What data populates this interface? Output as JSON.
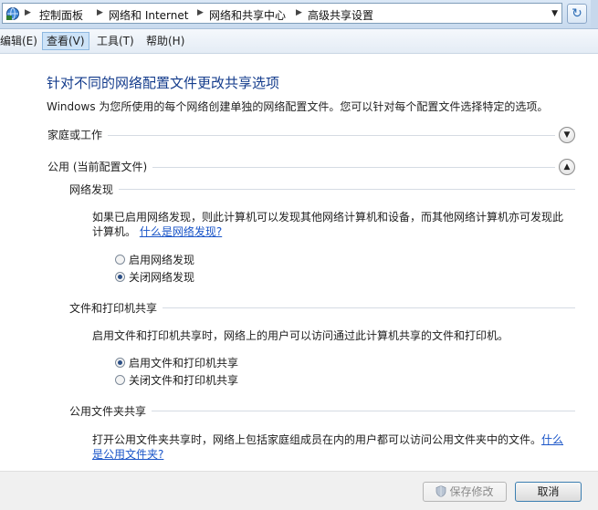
{
  "address_bar": {
    "crumbs": [
      "控制面板",
      "网络和 Internet",
      "网络和共享中心",
      "高级共享设置"
    ],
    "icon": "network-folder-icon",
    "dropdown_icon": "chevron-down-icon",
    "refresh_icon": "refresh-icon"
  },
  "menu": {
    "items": [
      "编辑(E)",
      "查看(V)",
      "工具(T)",
      "帮助(H)"
    ],
    "active_index": 1
  },
  "content": {
    "title": "针对不同的网络配置文件更改共享选项",
    "intro": "Windows 为您所使用的每个网络创建单独的网络配置文件。您可以针对每个配置文件选择特定的选项。",
    "profiles": [
      {
        "label": "家庭或工作",
        "expanded": false
      },
      {
        "label": "公用 (当前配置文件)",
        "expanded": true
      }
    ],
    "network_discovery": {
      "heading": "网络发现",
      "desc_line1": "如果已启用网络发现，则此计算机可以发现其他网络计算机和设备，而其他网络计算机亦可发现此",
      "desc_line2": "计算机。",
      "link": "什么是网络发现?",
      "options": [
        "启用网络发现",
        "关闭网络发现"
      ],
      "selected": 1
    },
    "file_printer_sharing": {
      "heading": "文件和打印机共享",
      "desc": "启用文件和打印机共享时，网络上的用户可以访问通过此计算机共享的文件和打印机。",
      "options": [
        "启用文件和打印机共享",
        "关闭文件和打印机共享"
      ],
      "selected": 0
    },
    "public_folder_sharing": {
      "heading": "公用文件夹共享",
      "desc": "打开公用文件夹共享时，网络上包括家庭组成员在内的用户都可以访问公用文件夹中的文件。",
      "link_part1": "什么",
      "link_part2": "是公用文件夹?"
    }
  },
  "buttons": {
    "save": "保存修改",
    "cancel": "取消"
  }
}
